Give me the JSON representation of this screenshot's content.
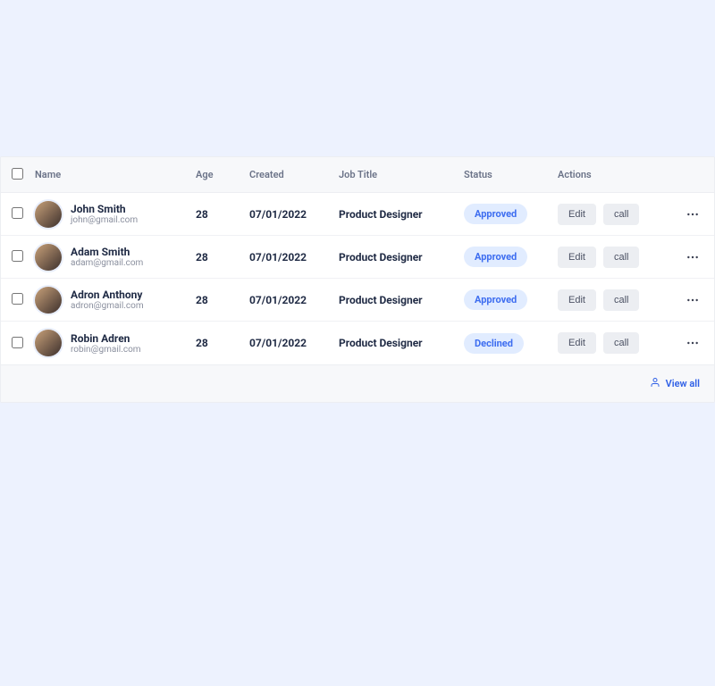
{
  "columns": {
    "name": "Name",
    "age": "Age",
    "created": "Created",
    "job": "Job Title",
    "status": "Status",
    "actions": "Actions"
  },
  "actions": {
    "edit": "Edit",
    "call": "call"
  },
  "rows": [
    {
      "name": "John Smith",
      "email": "john@gmail.com",
      "age": "28",
      "created": "07/01/2022",
      "job": "Product Designer",
      "status": "Approved"
    },
    {
      "name": "Adam Smith",
      "email": "adam@gmail.com",
      "age": "28",
      "created": "07/01/2022",
      "job": "Product Designer",
      "status": "Approved"
    },
    {
      "name": "Adron Anthony",
      "email": "adron@gmail.com",
      "age": "28",
      "created": "07/01/2022",
      "job": "Product Designer",
      "status": "Approved"
    },
    {
      "name": "Robin Adren",
      "email": "robin@gmail.com",
      "age": "28",
      "created": "07/01/2022",
      "job": "Product Designer",
      "status": "Declined"
    }
  ],
  "footer": {
    "view_all": "View all"
  }
}
